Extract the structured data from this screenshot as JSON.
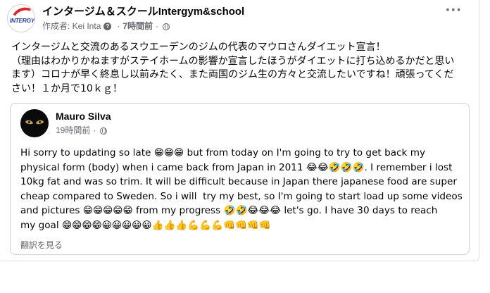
{
  "post": {
    "page_name": "インタージム＆スクールIntergym&school",
    "logo_text": "INTERGYM",
    "author_label": "作成者: Kei Inta",
    "time": "7時間前",
    "separator": "·",
    "more_label": "···",
    "icons": {
      "question": "?",
      "globe": "globe-icon"
    },
    "text": "インタージムと交流のあるスウエーデンのジムの代表のマウロさんダイエット宣言！\n（理由はわかりかねますがステイホームの影響か宣言したほうがダイエットに打ち込めるかだと思います）コロナが早く終息し以前みたく、また両国のジム生の方々と交流したいですね！頑張ってください！１か月で10ｋｇ！"
  },
  "shared_post": {
    "user_name": "Mauro Silva",
    "time": "19時間前",
    "separator": "·",
    "text": "Hi sorry to updating so late 😁😁😁 but from today on I'm going to try to get back my\nphysical form (body) when i came back from Japan in 2011 😂😂🤣🤣🤣. I remember i lost\n10kg fat and was so trim. It will be difficult because in Japan there japanese food are super\ncheap compared to Sweden. So i will  try my best, so I'm going to start load up some videos\nand pictures 😁😁😁😁😁 from my progress 🤣🤣😂😂😂 let's go. I have 30 days to reach\nmy goal 😁😁😁😁😀😀😀😀😀👍👍👍💪💪💪👊👊👊👊",
    "translate_label": "翻訳を見る"
  },
  "colors": {
    "text": "#050505",
    "meta": "#65676b",
    "border": "#ced0d4",
    "logo_red": "#d9242b",
    "logo_blue": "#2b3e9c"
  }
}
